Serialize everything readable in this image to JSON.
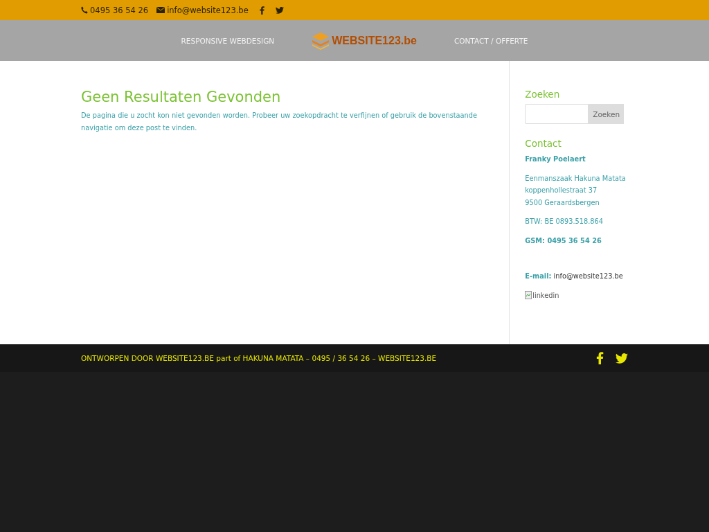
{
  "top_bar": {
    "phone": "0495 36 54 26",
    "email": "info@website123.be"
  },
  "nav": {
    "items": [
      "RESPONSIVE WEBDESIGN",
      "CONTACT / OFFERTE"
    ],
    "logo": "WEBSITE123.be"
  },
  "main": {
    "title": "Geen Resultaten Gevonden",
    "text": "De pagina die u zocht kon niet gevonden worden. Probeer uw zoekopdracht te verfijnen of gebruik de bovenstaande navigatie om deze post te vinden."
  },
  "sidebar": {
    "search": {
      "title": "Zoeken",
      "button": "Zoeken"
    },
    "contact": {
      "title": "Contact",
      "name": "Franky Poelaert",
      "address": [
        "Eenmanszaak Hakuna Matata",
        "koppenhollestraat 37",
        "9500 Geraardsbergen"
      ],
      "vat": "BTW: BE 0893.518.864",
      "gsm": "GSM: 0495 36 54 26",
      "email_label": "E-mail:",
      "email": "info@website123.be",
      "image_alt": "linkedin"
    }
  },
  "footer": {
    "credit": "ONTWORPEN DOOR WEBSITE123.BE part of HAKUNA MATATA – 0495 / 36 54 26 – WEBSITE123.BE"
  }
}
